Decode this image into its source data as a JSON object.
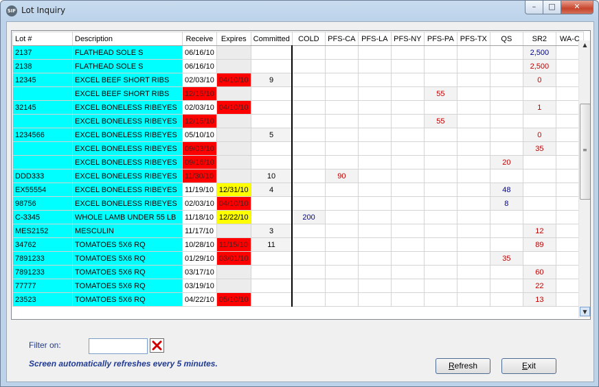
{
  "window": {
    "title": "Lot Inquiry",
    "app_icon_text": "SIF",
    "min_glyph": "–",
    "max_glyph": "□",
    "close_glyph": "✕"
  },
  "grid": {
    "columns": [
      "Lot #",
      "Description",
      "Receive",
      "Expires",
      "Committed",
      "COLD",
      "PFS-CA",
      "PFS-LA",
      "PFS-NY",
      "PFS-PA",
      "PFS-TX",
      "QS",
      "SR2",
      "WA-C"
    ],
    "rows": [
      {
        "lot": "2137",
        "desc": "FLATHEAD SOLE S",
        "receive": "06/16/10",
        "expires": "",
        "exp_color": "",
        "committed": "",
        "cold": "",
        "ca": "",
        "pa": "",
        "qs": "",
        "sr2": "2,500",
        "sr2_color": "blue"
      },
      {
        "lot": "2138",
        "desc": "FLATHEAD SOLE S",
        "receive": "06/16/10",
        "expires": "",
        "exp_color": "",
        "committed": "",
        "cold": "",
        "ca": "",
        "pa": "",
        "qs": "",
        "sr2": "2,500",
        "sr2_color": "red"
      },
      {
        "lot": "12345",
        "desc": "EXCEL BEEF SHORT RIBS",
        "receive": "02/03/10",
        "expires": "04/10/10",
        "exp_color": "red",
        "committed": "9",
        "cold": "",
        "ca": "",
        "pa": "",
        "qs": "",
        "sr2": "0",
        "sr2_color": "red"
      },
      {
        "lot": "",
        "desc": "EXCEL BEEF SHORT RIBS",
        "receive": "12/15/10",
        "receive_color": "red",
        "expires": "",
        "exp_color": "",
        "committed": "",
        "cold": "",
        "ca": "",
        "pa": "55",
        "qs": "",
        "sr2": "",
        "sr2_color": ""
      },
      {
        "lot": "32145",
        "desc": "EXCEL BONELESS RIBEYES",
        "receive": "02/03/10",
        "expires": "04/10/10",
        "exp_color": "red",
        "committed": "",
        "cold": "",
        "ca": "",
        "pa": "",
        "qs": "",
        "sr2": "1",
        "sr2_color": "red"
      },
      {
        "lot": "",
        "desc": "EXCEL BONELESS RIBEYES",
        "receive": "12/15/10",
        "receive_color": "red",
        "expires": "",
        "exp_color": "",
        "committed": "",
        "cold": "",
        "ca": "",
        "pa": "55",
        "qs": "",
        "sr2": "",
        "sr2_color": ""
      },
      {
        "lot": "1234566",
        "desc": "EXCEL BONELESS RIBEYES",
        "receive": "05/10/10",
        "expires": "",
        "exp_color": "",
        "committed": "5",
        "cold": "",
        "ca": "",
        "pa": "",
        "qs": "",
        "sr2": "0",
        "sr2_color": "red"
      },
      {
        "lot": "",
        "desc": "EXCEL BONELESS RIBEYES",
        "receive": "09/03/10",
        "receive_color": "red",
        "expires": "",
        "exp_color": "",
        "committed": "",
        "cold": "",
        "ca": "",
        "pa": "",
        "qs": "",
        "sr2": "35",
        "sr2_color": "red"
      },
      {
        "lot": "",
        "desc": "EXCEL BONELESS RIBEYES",
        "receive": "09/16/10",
        "receive_color": "red",
        "expires": "",
        "exp_color": "",
        "committed": "",
        "cold": "",
        "ca": "",
        "pa": "",
        "qs": "20",
        "qs_color": "red",
        "sr2": "",
        "sr2_color": ""
      },
      {
        "lot": "DDD333",
        "desc": "EXCEL BONELESS RIBEYES",
        "receive": "11/30/10",
        "receive_color": "red",
        "expires": "",
        "exp_color": "",
        "committed": "10",
        "cold": "",
        "ca": "90",
        "pa": "",
        "qs": "",
        "sr2": "",
        "sr2_color": ""
      },
      {
        "lot": "EX55554",
        "desc": "EXCEL BONELESS RIBEYES",
        "receive": "11/19/10",
        "expires": "12/31/10",
        "exp_color": "yellow",
        "committed": "4",
        "cold": "",
        "ca": "",
        "pa": "",
        "qs": "48",
        "qs_color": "blue",
        "sr2": "",
        "sr2_color": ""
      },
      {
        "lot": "98756",
        "desc": "EXCEL BONELESS RIBEYES",
        "receive": "02/03/10",
        "expires": "04/10/10",
        "exp_color": "red",
        "committed": "",
        "cold": "",
        "ca": "",
        "pa": "",
        "qs": "8",
        "qs_color": "blue",
        "sr2": "",
        "sr2_color": ""
      },
      {
        "lot": "C-3345",
        "desc": "WHOLE LAMB UNDER 55 LB",
        "receive": "11/18/10",
        "expires": "12/22/10",
        "exp_color": "yellow",
        "committed": "",
        "cold": "200",
        "ca": "",
        "pa": "",
        "qs": "",
        "sr2": "",
        "sr2_color": ""
      },
      {
        "lot": "MES2152",
        "desc": "MESCULIN",
        "receive": "11/17/10",
        "expires": "",
        "exp_color": "",
        "committed": "3",
        "cold": "",
        "ca": "",
        "pa": "",
        "qs": "",
        "sr2": "12",
        "sr2_color": "red"
      },
      {
        "lot": "34762",
        "desc": "TOMATOES 5X6 RQ",
        "receive": "10/28/10",
        "expires": "11/15/10",
        "exp_color": "red",
        "committed": "11",
        "cold": "",
        "ca": "",
        "pa": "",
        "qs": "",
        "sr2": "89",
        "sr2_color": "red"
      },
      {
        "lot": "7891233",
        "desc": "TOMATOES 5X6 RQ",
        "receive": "01/29/10",
        "expires": "03/01/10",
        "exp_color": "red",
        "committed": "",
        "cold": "",
        "ca": "",
        "pa": "",
        "qs": "35",
        "qs_color": "red",
        "sr2": "",
        "sr2_color": ""
      },
      {
        "lot": "7891233",
        "desc": "TOMATOES 5X6 RQ",
        "receive": "03/17/10",
        "expires": "",
        "exp_color": "",
        "committed": "",
        "cold": "",
        "ca": "",
        "pa": "",
        "qs": "",
        "sr2": "60",
        "sr2_color": "red"
      },
      {
        "lot": "77777",
        "desc": "TOMATOES 5X6 RQ",
        "receive": "03/19/10",
        "expires": "",
        "exp_color": "",
        "committed": "",
        "cold": "",
        "ca": "",
        "pa": "",
        "qs": "",
        "sr2": "22",
        "sr2_color": "red"
      },
      {
        "lot": "23523",
        "desc": "TOMATOES 5X6 RQ",
        "receive": "04/22/10",
        "expires": "05/10/10",
        "exp_color": "red",
        "committed": "",
        "cold": "",
        "ca": "",
        "pa": "",
        "qs": "",
        "sr2": "13",
        "sr2_color": "red"
      }
    ]
  },
  "scrollbars": {
    "vertical_grip": "≡",
    "horizontal_grip": "‖‖‖",
    "left_arrow": "◀",
    "right_arrow": "▶",
    "up_arrow": "▲",
    "down_arrow": "▼"
  },
  "filter": {
    "label": "Filter on:",
    "value": "",
    "clear_glyph": "✖"
  },
  "note": "Screen automatically refreshes every 5 minutes.",
  "buttons": {
    "refresh": "Refresh",
    "exit": "Exit"
  },
  "colors": {
    "cyan": "#00ffff",
    "red": "#ff0000",
    "yellow": "#ffff00",
    "text_blue": "#1f3a93",
    "qty_red": "#c00000",
    "qty_blue": "#00008b"
  }
}
